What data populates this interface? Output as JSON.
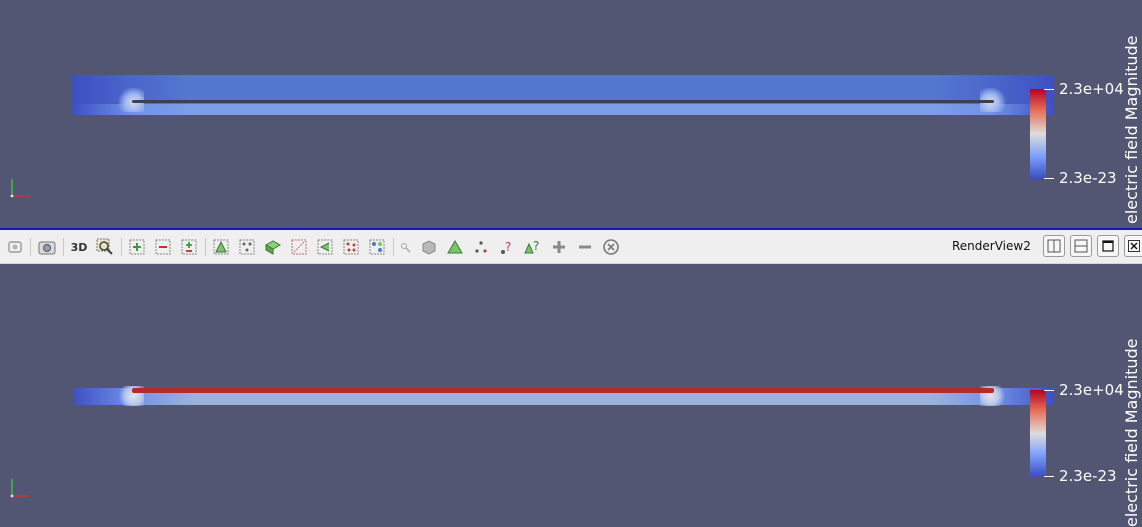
{
  "top_view": {
    "colorbar": {
      "max_label": "2.3e+04",
      "min_label": "2.3e-23",
      "title": "electric field Magnitude"
    }
  },
  "bottom_view": {
    "colorbar": {
      "max_label": "2.3e+04",
      "min_label": "2.3e-23",
      "title": "electric field Magnitude"
    }
  },
  "toolbar": {
    "view_name": "RenderView2",
    "icons": [
      "reset-session-icon",
      "screenshot-icon",
      "toggle-3d-icon",
      "zoom-to-box-icon",
      "select-cells-on-icon",
      "select-points-on-icon",
      "select-cells-through-icon",
      "select-points-through-icon",
      "select-polygon-icon",
      "select-blocks-icon",
      "interactive-select-cells-icon",
      "interactive-select-points-icon",
      "hover-points-icon",
      "hover-cells-icon",
      "grow-selection-icon",
      "shrink-selection-icon",
      "clear-selection-icon"
    ],
    "window_buttons": [
      "split-horizontal-icon",
      "split-vertical-icon",
      "maximize-icon",
      "close-icon"
    ],
    "three_d_label": "3D"
  },
  "colors": {
    "background": "#525672",
    "active_border": "#1414c8",
    "colormap_high": "#b40426",
    "colormap_mid": "#dddcdc",
    "colormap_low": "#3b4cc0"
  }
}
